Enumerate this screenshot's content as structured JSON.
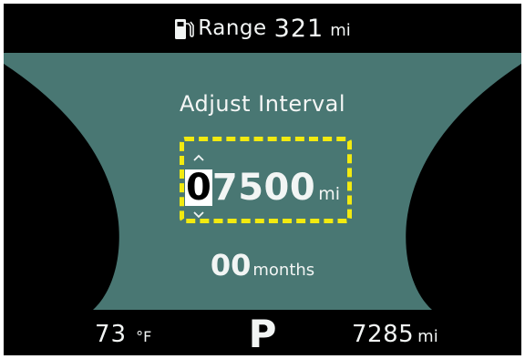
{
  "top_bar": {
    "range_label": "Range",
    "range_value": "321",
    "range_unit": "mi",
    "icon": "fuel-pump-icon"
  },
  "screen": {
    "title": "Adjust Interval",
    "interval_cursor_digit": "0",
    "interval_rest": "7500",
    "interval_unit": "mi",
    "months_value": "00",
    "months_unit": "months"
  },
  "bottom_bar": {
    "temp_value": "73",
    "temp_unit": "°F",
    "gear": "P",
    "odometer_value": "7285",
    "odometer_unit": "mi"
  },
  "colors": {
    "panel": "#497773",
    "background": "#000000",
    "text": "#f2f5f4",
    "highlight": "#f2ea10"
  }
}
